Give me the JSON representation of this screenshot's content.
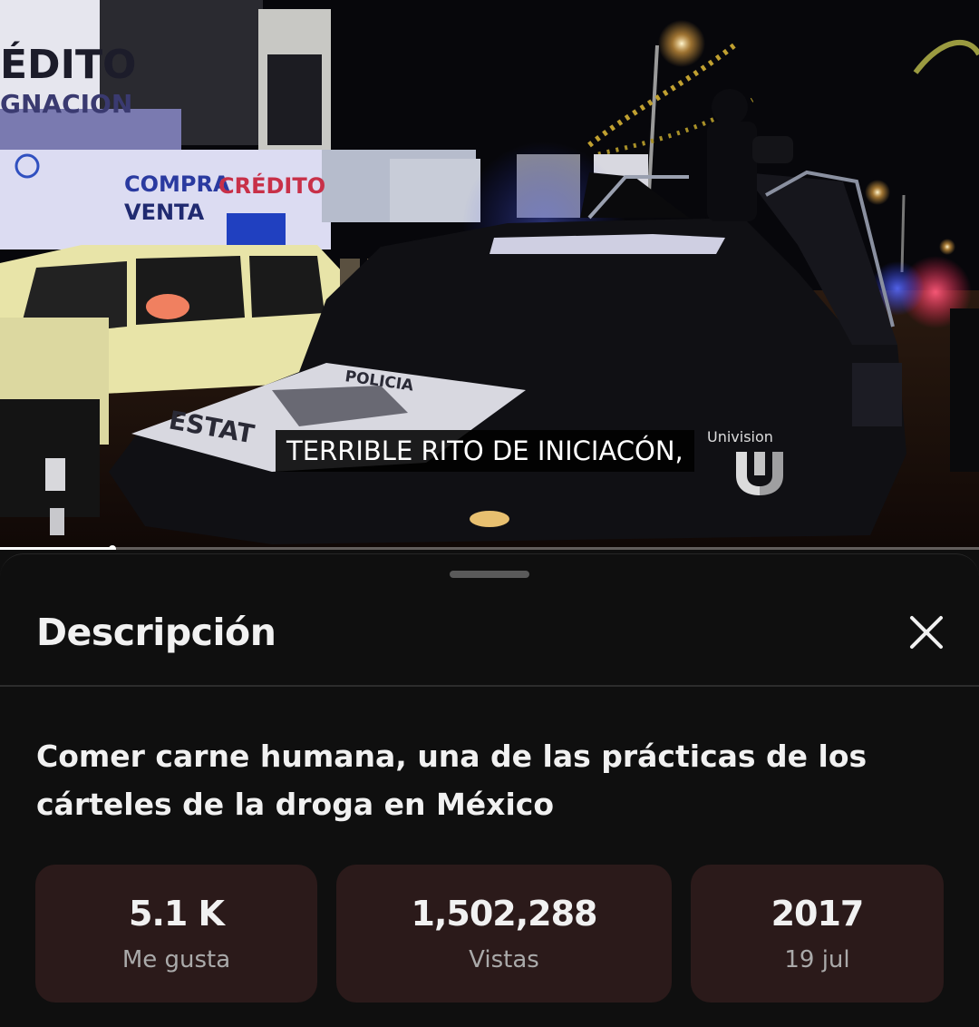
{
  "video": {
    "subtitle": "TERRIBLE RITO DE INICIACÓN,",
    "watermark": "Univision",
    "scene_signs": {
      "sign_top_1": "ÉDITO",
      "sign_top_2": "GNACION",
      "shop_line_1a": "COMPRA",
      "shop_line_1b": "CRÉDITO",
      "shop_line_2": "VENTA",
      "hood_text_1": "POLICIA",
      "hood_text_2": "ESTAT"
    },
    "progress_fraction": 0.115
  },
  "sheet": {
    "title": "Descripción",
    "video_title": "Comer carne humana, una de las prácticas de los cárteles de la droga en México",
    "close_icon": "close-icon",
    "stats": [
      {
        "value": "5.1 K",
        "label": "Me gusta"
      },
      {
        "value": "1,502,288",
        "label": "Vistas"
      },
      {
        "value": "2017",
        "label": "19 jul"
      }
    ]
  },
  "colors": {
    "background": "#0f0f0f",
    "stat_card": "#2b1a1a",
    "primary_text": "#f1f1f1",
    "secondary_text": "#aaaaaa"
  }
}
